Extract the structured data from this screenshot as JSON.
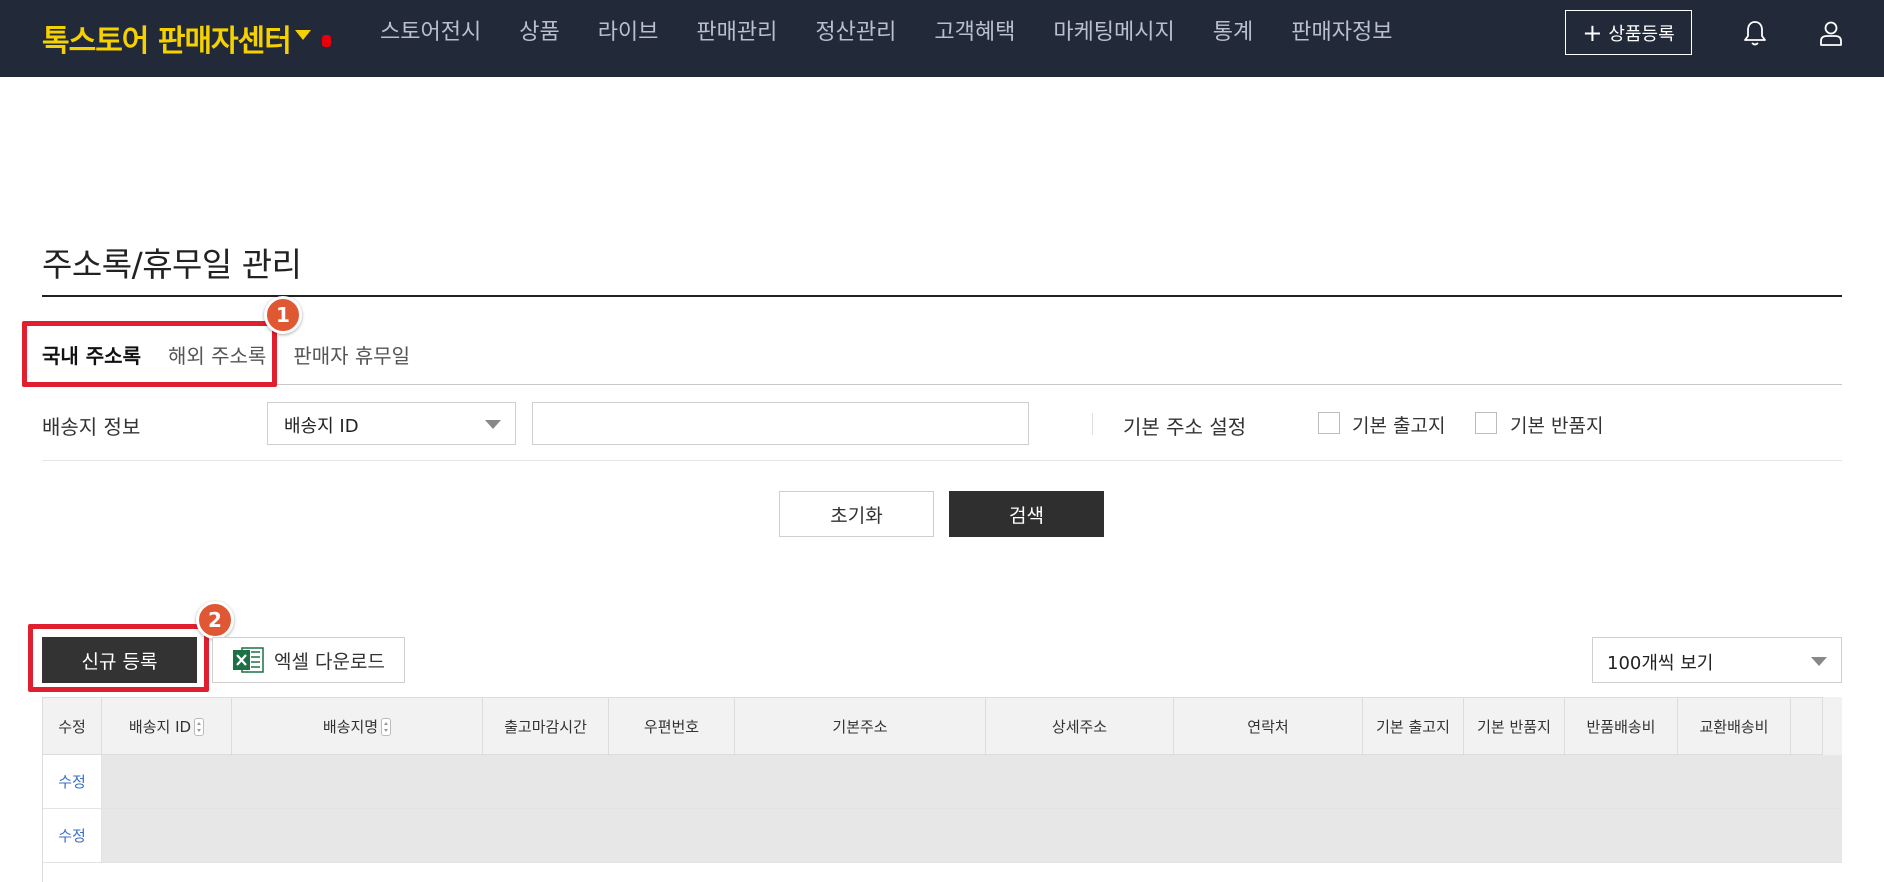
{
  "header": {
    "brand_main": "톡스토어",
    "brand_sub": "판매자센터",
    "nav": [
      "스토어전시",
      "상품",
      "라이브",
      "판매관리",
      "정산관리",
      "고객혜택",
      "마케팅메시지",
      "통계",
      "판매자정보"
    ],
    "register_label": "상품등록",
    "icons": [
      "bell-icon",
      "user-icon"
    ]
  },
  "page": {
    "title": "주소록/휴무일 관리"
  },
  "tabs": [
    {
      "label": "국내 주소록",
      "active": true
    },
    {
      "label": "해외 주소록",
      "active": false
    },
    {
      "label": "판매자 휴무일",
      "active": false
    }
  ],
  "callouts": [
    "1",
    "2"
  ],
  "filter": {
    "label": "배송지 정보",
    "select_value": "배송지 ID",
    "input_value": "",
    "default_label": "기본 주소 설정",
    "checkbox_ship": "기본 출고지",
    "checkbox_return": "기본 반품지",
    "reset_label": "초기화",
    "search_label": "검색"
  },
  "actions": {
    "new_label": "신규 등록",
    "excel_label": "엑셀 다운로드",
    "page_size": "100개씩 보기"
  },
  "table": {
    "headers": [
      "수정",
      "배송지 ID",
      "배송지명",
      "출고마감시간",
      "우편번호",
      "기본주소",
      "상세주소",
      "연락처",
      "기본 출고지",
      "기본 반품지",
      "반품배송비",
      "교환배송비"
    ],
    "sortable": [
      "배송지 ID",
      "배송지명"
    ],
    "rows": [
      {
        "edit": "수정"
      },
      {
        "edit": "수정"
      }
    ]
  },
  "colors": {
    "topbar": "#222a3a",
    "brand": "#f5d100",
    "callout_border": "#e0202f",
    "callout_badge": "#e05733",
    "link": "#3b6fc4"
  }
}
